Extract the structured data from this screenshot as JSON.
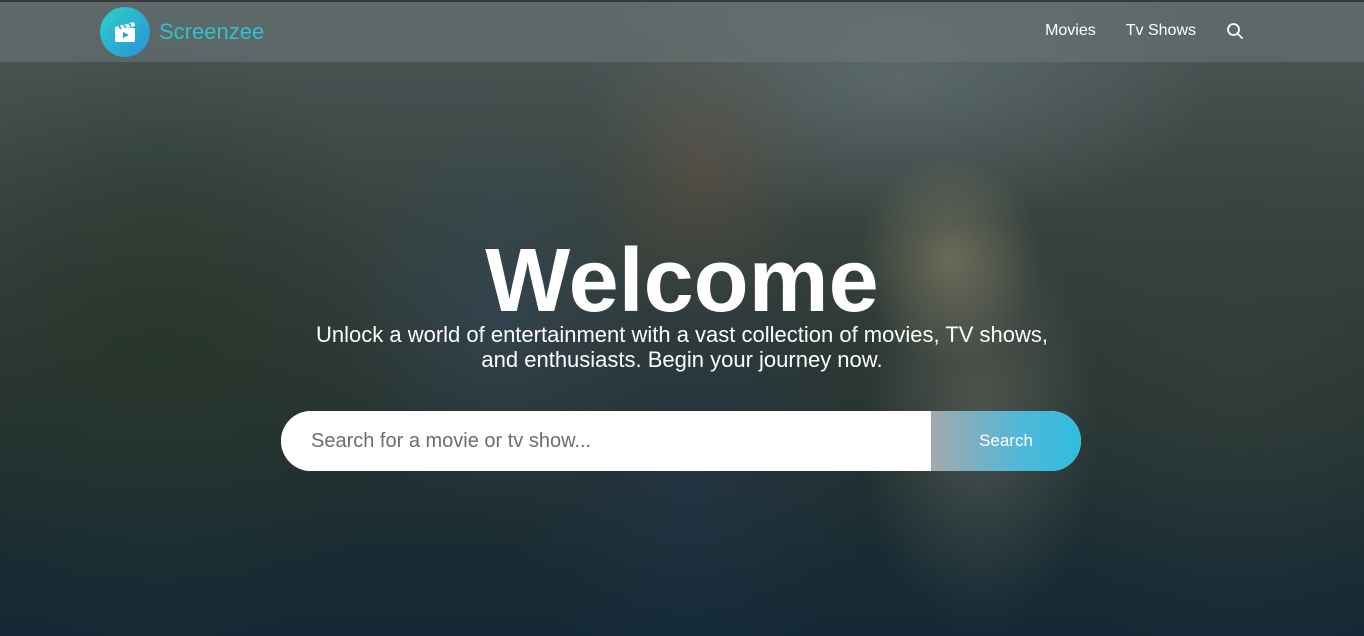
{
  "brand": {
    "name": "Screenzee",
    "logo_icon": "clapperboard-icon",
    "accent_color": "#2fc2d0"
  },
  "nav": {
    "items": [
      {
        "label": "Movies"
      },
      {
        "label": "Tv Shows"
      }
    ],
    "search_icon": "search-icon"
  },
  "hero": {
    "title": "Welcome",
    "tagline_line1": "Unlock a world of entertainment with a vast collection of movies, TV shows,",
    "tagline_line2": "and enthusiasts. Begin your journey now.",
    "search": {
      "placeholder": "Search for a movie or tv show...",
      "value": "",
      "button_label": "Search"
    }
  }
}
